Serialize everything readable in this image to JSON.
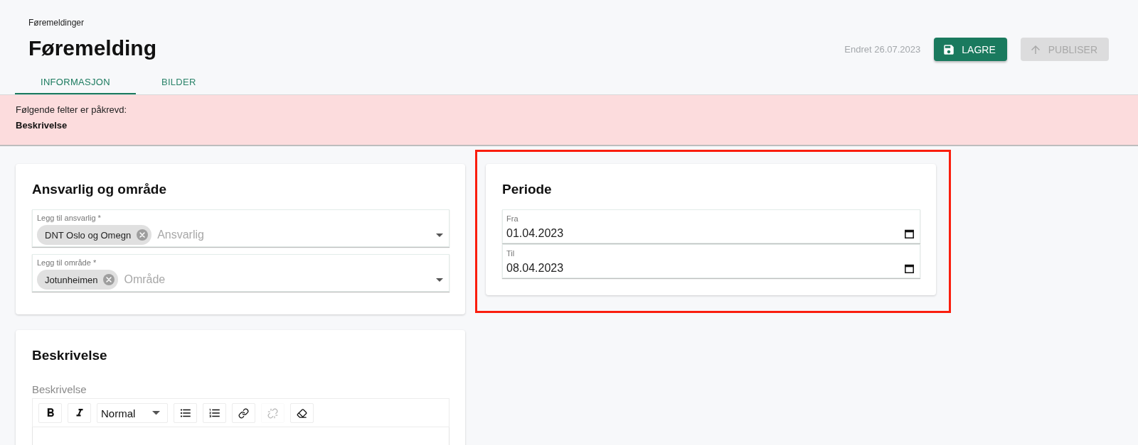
{
  "breadcrumb": "Føremeldinger",
  "title": "Føremelding",
  "tabs": [
    {
      "label": "INFORMASJON",
      "selected": true
    },
    {
      "label": "BILDER",
      "selected": false
    }
  ],
  "changed": "Endret 26.07.2023",
  "actions": [
    {
      "label": "LAGRE",
      "kind": "save",
      "disabled": false
    },
    {
      "label": "PUBLISER",
      "kind": "publish",
      "disabled": true
    }
  ],
  "error_banner": {
    "message": "Følgende felter er påkrevd:",
    "fields": [
      "Beskrivelse"
    ]
  },
  "responsible_area": {
    "title": "Ansvarlig og område",
    "fields": [
      {
        "label": "Legg til ansvarlig *",
        "chips": [
          "DNT Oslo og Omegn"
        ],
        "placeholder": "Ansvarlig"
      },
      {
        "label": "Legg til område *",
        "chips": [
          "Jotunheimen"
        ],
        "placeholder": "Område"
      }
    ]
  },
  "period": {
    "title": "Periode",
    "highlighted": true,
    "fields": [
      {
        "label": "Fra",
        "value": "01.04.2023"
      },
      {
        "label": "Til",
        "value": "08.04.2023"
      }
    ]
  },
  "description": {
    "title": "Beskrivelse",
    "label": "Beskrivelse",
    "toolbar": [
      {
        "kind": "bold",
        "disabled": false
      },
      {
        "kind": "italic",
        "disabled": false
      },
      {
        "kind": "blocktype",
        "value": "Normal",
        "disabled": false
      },
      {
        "kind": "bullets",
        "disabled": false
      },
      {
        "kind": "numbered",
        "disabled": false
      },
      {
        "kind": "link",
        "disabled": false
      },
      {
        "kind": "unlink",
        "disabled": true
      },
      {
        "kind": "eraser",
        "disabled": false
      }
    ]
  }
}
